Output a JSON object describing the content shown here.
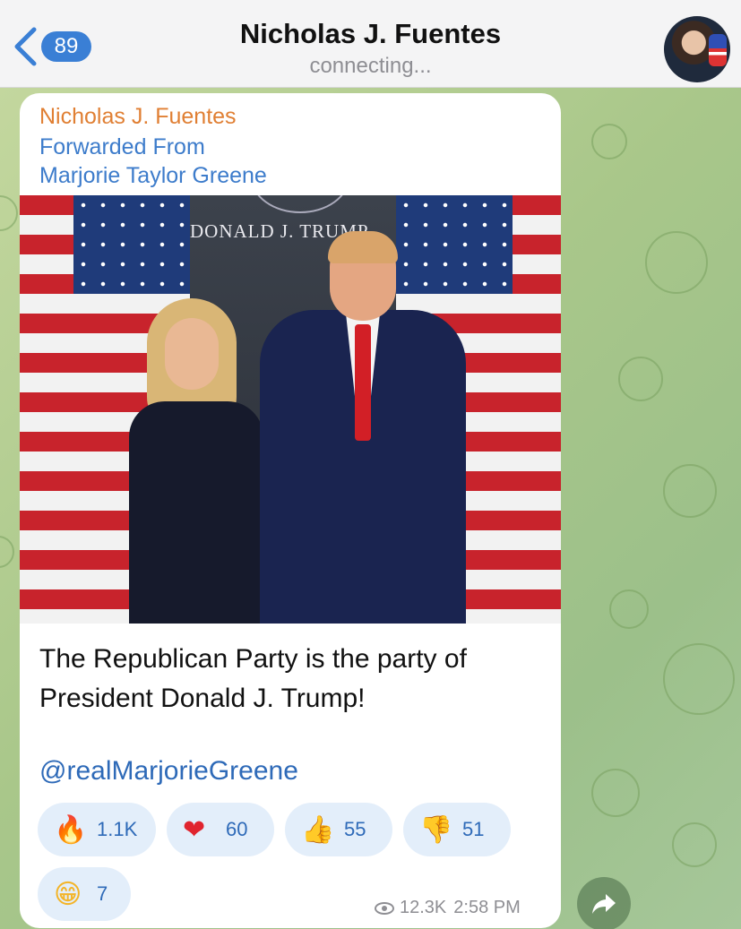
{
  "header": {
    "unread_count": "89",
    "title": "Nicholas J. Fuentes",
    "status": "connecting..."
  },
  "message": {
    "sender": "Nicholas J. Fuentes",
    "forwarded_label": "Forwarded From",
    "forwarded_from": "Marjorie Taylor Greene",
    "photo_banner_text": "DONALD J. TRUMP",
    "text_line1": "The Republican Party is the party of",
    "text_line2": "President Donald J. Trump!",
    "mention": "@realMarjorieGreene",
    "views": "12.3K",
    "time": "2:58 PM"
  },
  "reactions": [
    {
      "emoji": "🔥",
      "icon": "fire-icon",
      "count": "1.1K"
    },
    {
      "emoji": "❤",
      "icon": "heart-icon",
      "count": "60"
    },
    {
      "emoji": "👍",
      "icon": "thumbs-up-icon",
      "count": "55"
    },
    {
      "emoji": "👎",
      "icon": "thumbs-down-icon",
      "count": "51"
    },
    {
      "emoji": "😁",
      "icon": "grin-icon",
      "count": "7"
    }
  ],
  "colors": {
    "accent": "#3a7fd5",
    "sender": "#e07f33",
    "link": "#2e6ab8",
    "reaction_bg": "#e3eefa"
  }
}
